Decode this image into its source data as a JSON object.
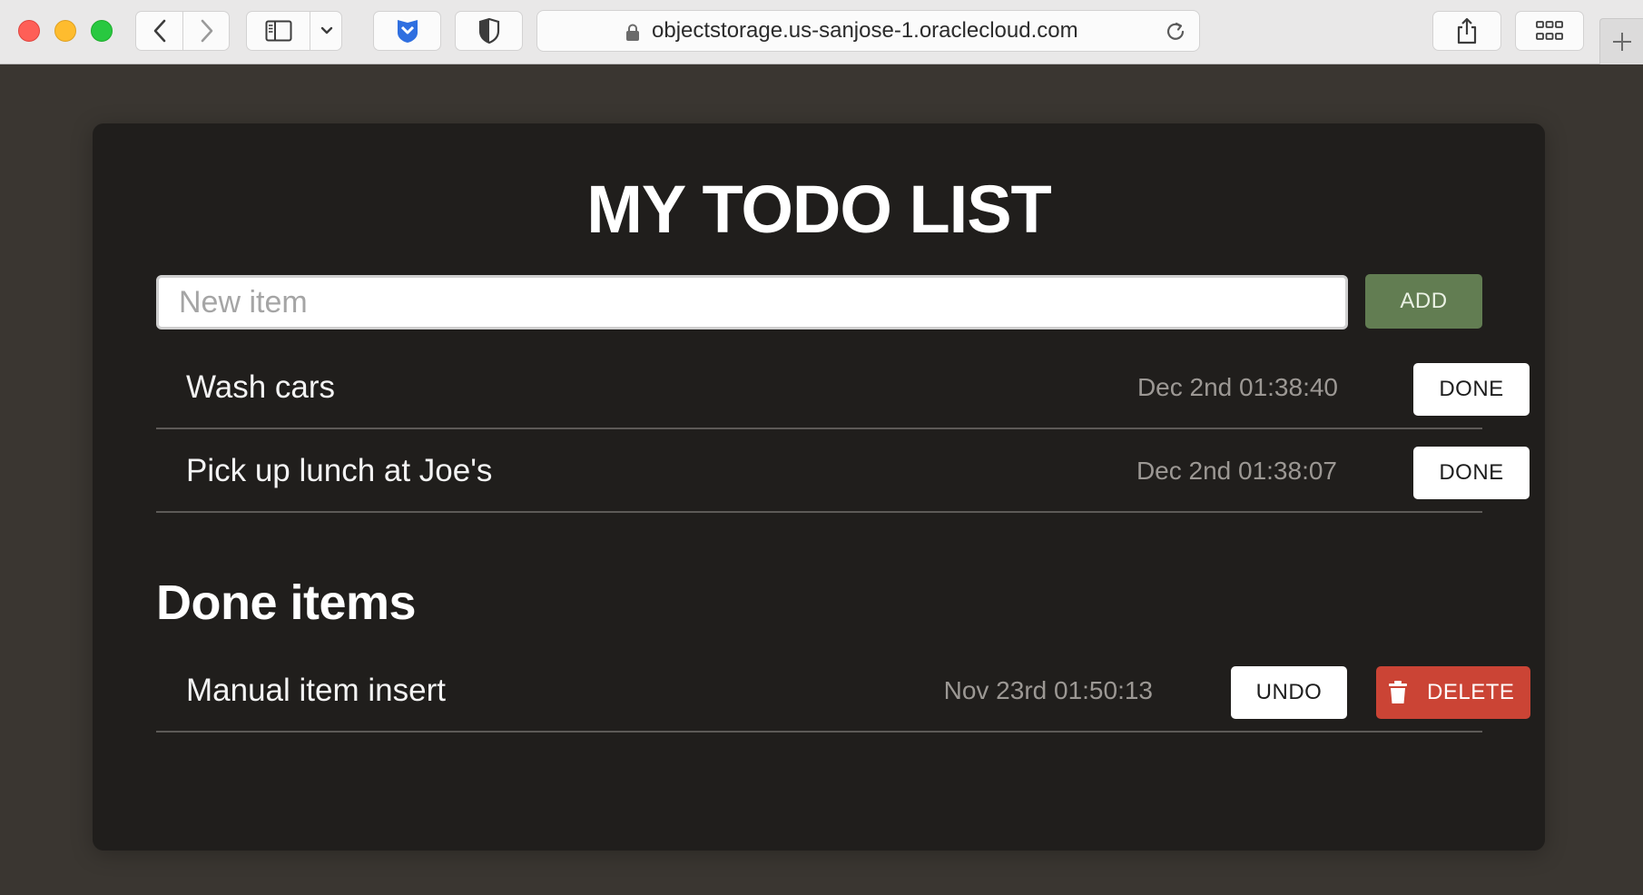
{
  "browser": {
    "url": "objectstorage.us-sanjose-1.oraclecloud.com"
  },
  "app": {
    "title": "MY TODO LIST",
    "input_placeholder": "New item",
    "add_label": "ADD",
    "todo_items": [
      {
        "text": "Wash cars",
        "time": "Dec 2nd 01:38:40",
        "action": "DONE"
      },
      {
        "text": "Pick up lunch at Joe's",
        "time": "Dec 2nd 01:38:07",
        "action": "DONE"
      }
    ],
    "done_heading": "Done items",
    "done_items": [
      {
        "text": "Manual item insert",
        "time": "Nov 23rd 01:50:13",
        "undo": "UNDO",
        "delete": "DELETE"
      }
    ],
    "colors": {
      "background": "#3a3631",
      "card": "#201e1c",
      "add_button": "#627d52",
      "delete_button": "#cb4435"
    }
  }
}
